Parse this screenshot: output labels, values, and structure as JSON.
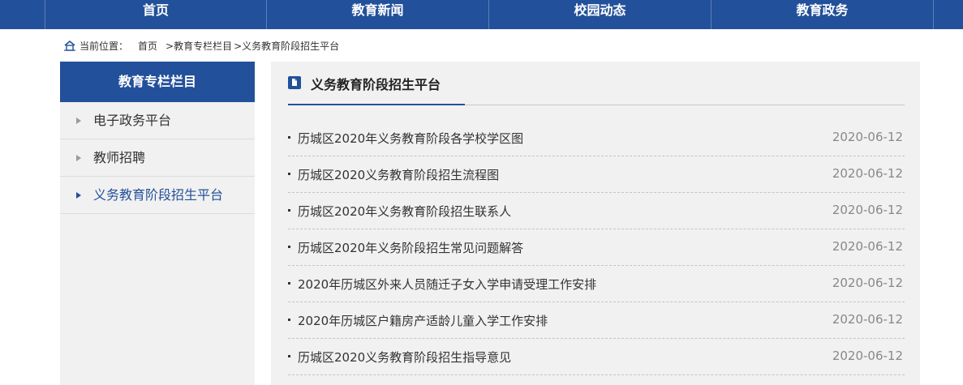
{
  "nav": [
    "首页",
    "教育新闻",
    "校园动态",
    "教育政务"
  ],
  "breadcrumb": {
    "prefix": "当前位置：",
    "items": [
      "首页",
      ">教育专栏栏目",
      ">义务教育阶段招生平台"
    ]
  },
  "sidebar": {
    "title": "教育专栏栏目",
    "items": [
      {
        "label": "电子政务平台",
        "active": false
      },
      {
        "label": "教师招聘",
        "active": false
      },
      {
        "label": "义务教育阶段招生平台",
        "active": true
      }
    ]
  },
  "content": {
    "title": "义务教育阶段招生平台",
    "rows": [
      {
        "title": "历城区2020年义务教育阶段各学校学区图",
        "date": "2020-06-12"
      },
      {
        "title": "历城区2020义务教育阶段招生流程图",
        "date": "2020-06-12"
      },
      {
        "title": "历城区2020年义务教育阶段招生联系人",
        "date": "2020-06-12"
      },
      {
        "title": "历城区2020年义务阶段招生常见问题解答",
        "date": "2020-06-12"
      },
      {
        "title": "2020年历城区外来人员随迁子女入学申请受理工作安排",
        "date": "2020-06-12"
      },
      {
        "title": "2020年历城区户籍房产适龄儿童入学工作安排",
        "date": "2020-06-12"
      },
      {
        "title": "历城区2020义务教育阶段招生指导意见",
        "date": "2020-06-12"
      }
    ]
  },
  "colors": {
    "brand": "#23509a",
    "panel": "#f1f1f1"
  }
}
